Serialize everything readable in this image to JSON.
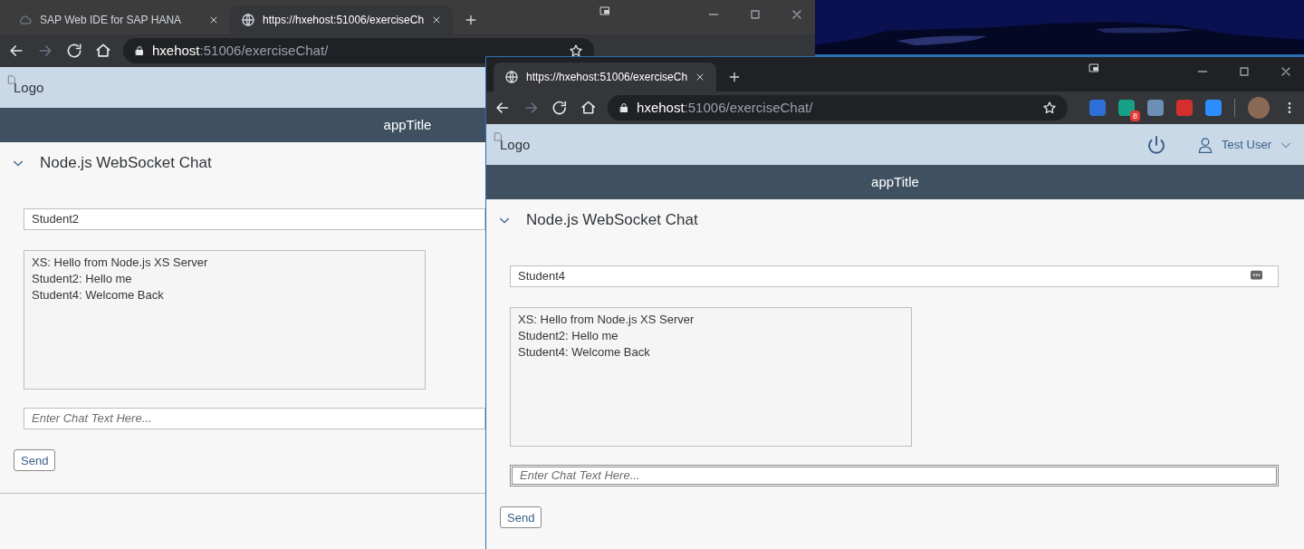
{
  "windows": [
    {
      "focused": false,
      "tabs": [
        {
          "title": "SAP Web IDE for SAP HANA",
          "kind": "app",
          "selected": false
        },
        {
          "title": "https://hxehost:51006/exerciseCh",
          "kind": "page",
          "selected": true
        }
      ],
      "url": {
        "host": "hxehost",
        "rest": ":51006/exerciseChat/"
      },
      "logo": "Logo",
      "app_title": "appTitle",
      "panel": {
        "title": "Node.js WebSocket Chat",
        "expanded": true
      },
      "name_field": {
        "value": "Student2"
      },
      "messages": [
        "XS: Hello from Node.js XS Server",
        "Student2: Hello me",
        "Student4: Welcome Back"
      ],
      "chat_field": {
        "placeholder": "Enter Chat Text Here...",
        "focused": false
      },
      "send": "Send"
    },
    {
      "focused": true,
      "tabs": [
        {
          "title": "https://hxehost:51006/exerciseCh",
          "kind": "page",
          "selected": true
        }
      ],
      "url": {
        "host": "hxehost",
        "rest": ":51006/exerciseChat/"
      },
      "extensions": [
        {
          "color": "#2d6fd6"
        },
        {
          "color": "#16a085",
          "badge": "8"
        },
        {
          "color": "#6b8fb5"
        },
        {
          "color": "#d32f2f"
        },
        {
          "color": "#2d8cff"
        }
      ],
      "logo": "Logo",
      "user": "Test User",
      "app_title": "appTitle",
      "panel": {
        "title": "Node.js WebSocket Chat",
        "expanded": true
      },
      "name_field": {
        "value": "Student4"
      },
      "messages": [
        "XS: Hello from Node.js XS Server",
        "Student2: Hello me",
        "Student4: Welcome Back"
      ],
      "chat_field": {
        "placeholder": "Enter Chat Text Here...",
        "focused": true
      },
      "send": "Send"
    }
  ]
}
